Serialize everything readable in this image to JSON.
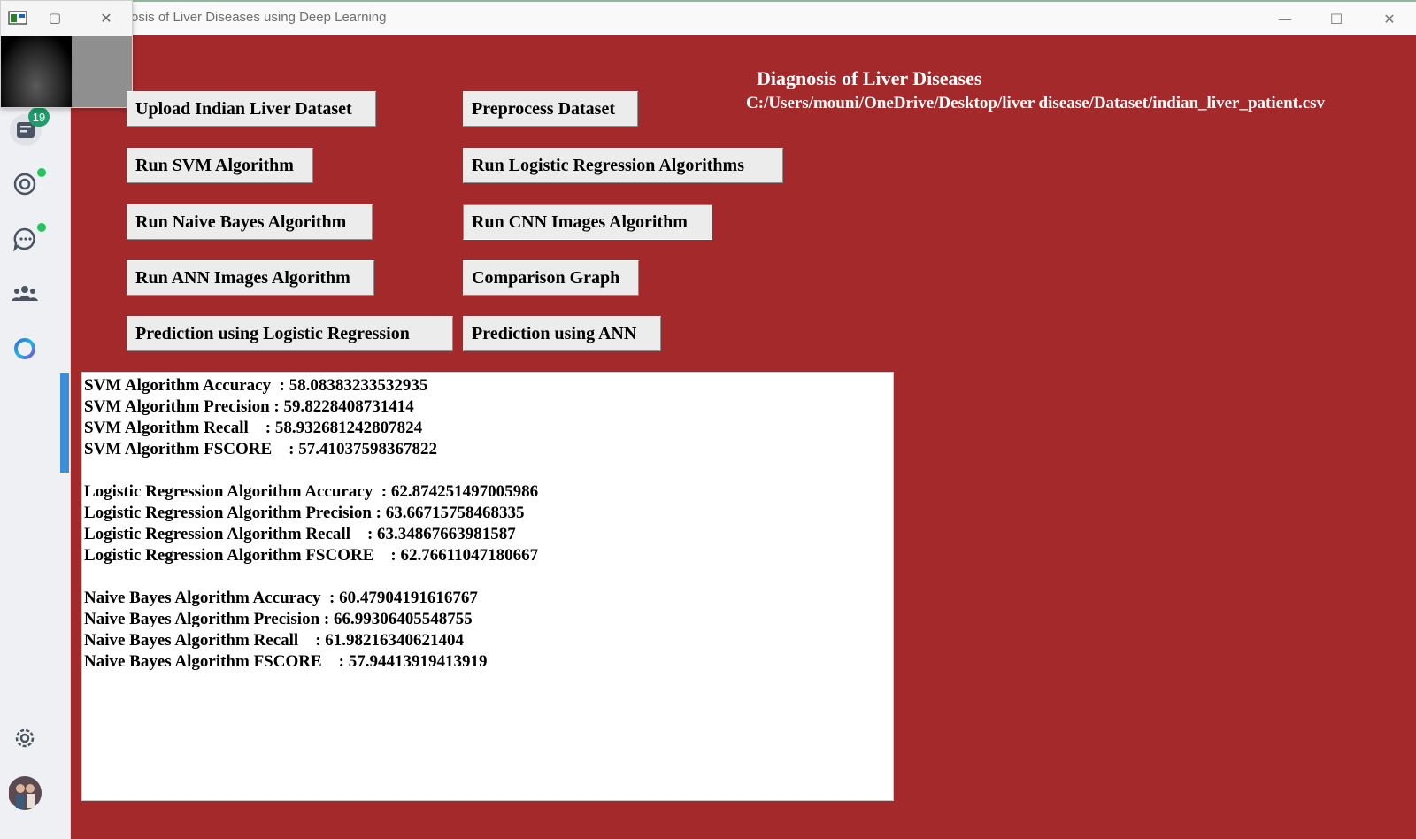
{
  "window": {
    "title": "osis of Liver Diseases using Deep Learning",
    "controls": {
      "minimize": "—",
      "maximize": "☐",
      "close": "✕"
    }
  },
  "preview_popup": {
    "controls": {
      "restore": "▢",
      "close": "✕"
    }
  },
  "sidebar": {
    "badge_count": "19",
    "items": [
      {
        "icon": "inbox-icon"
      },
      {
        "icon": "status-icon",
        "dot": true
      },
      {
        "icon": "chat-icon",
        "dot": true
      },
      {
        "icon": "people-icon"
      },
      {
        "icon": "copilot-ring-icon"
      }
    ],
    "settings_icon": "gear-icon",
    "avatar": "avatar"
  },
  "app": {
    "heading": "Diagnosis of Liver Diseases",
    "file_path": "C:/Users/mouni/OneDrive/Desktop/liver disease/Dataset/indian_liver_patient.csv",
    "buttons": {
      "upload": "Upload Indian Liver Dataset",
      "preprocess": "Preprocess Dataset",
      "svm": "Run SVM Algorithm",
      "logistic": "Run Logistic Regression Algorithms",
      "naive_bayes": "Run Naive Bayes Algorithm",
      "cnn": "Run CNN Images Algorithm",
      "ann": "Run ANN Images Algorithm",
      "comparison": "Comparison Graph",
      "predict_lr": "Prediction using Logistic Regression",
      "predict_ann": "Prediction using ANN"
    },
    "output_lines": [
      "SVM Algorithm Accuracy  : 58.08383233532935",
      "SVM Algorithm Precision : 59.8228408731414",
      "SVM Algorithm Recall    : 58.932681242807824",
      "SVM Algorithm FSCORE    : 57.41037598367822",
      "",
      "Logistic Regression Algorithm Accuracy  : 62.874251497005986",
      "Logistic Regression Algorithm Precision : 63.66715758468335",
      "Logistic Regression Algorithm Recall    : 63.34867663981587",
      "Logistic Regression Algorithm FSCORE    : 62.76611047180667",
      "",
      "Naive Bayes Algorithm Accuracy  : 60.47904191616767",
      "Naive Bayes Algorithm Precision : 66.99306405548755",
      "Naive Bayes Algorithm Recall    : 61.98216340621404",
      "Naive Bayes Algorithm FSCORE    : 57.94413919413919"
    ]
  },
  "colors": {
    "app_background": "#a4292b",
    "button_face": "#ececec",
    "accent_blue": "#3a8fd6",
    "badge_green": "#1f9d6b"
  }
}
